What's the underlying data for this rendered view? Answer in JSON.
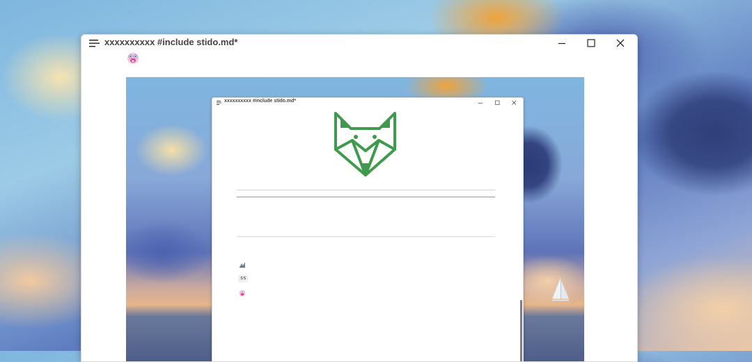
{
  "window": {
    "title": "xxxxxxxxxx #include stido.md*",
    "buttons": {
      "minimize": "minimize-icon",
      "maximize": "maximize-icon",
      "close": "close-icon"
    }
  },
  "preview": {
    "window": {
      "title": "xxxxxxxxxx #include stido.md*"
    },
    "logo": "fox-logo",
    "code_text": "ss"
  },
  "colors": {
    "fox_green": "#3f9a4e",
    "title_text": "#444444",
    "rule": "#cfcfcf"
  }
}
